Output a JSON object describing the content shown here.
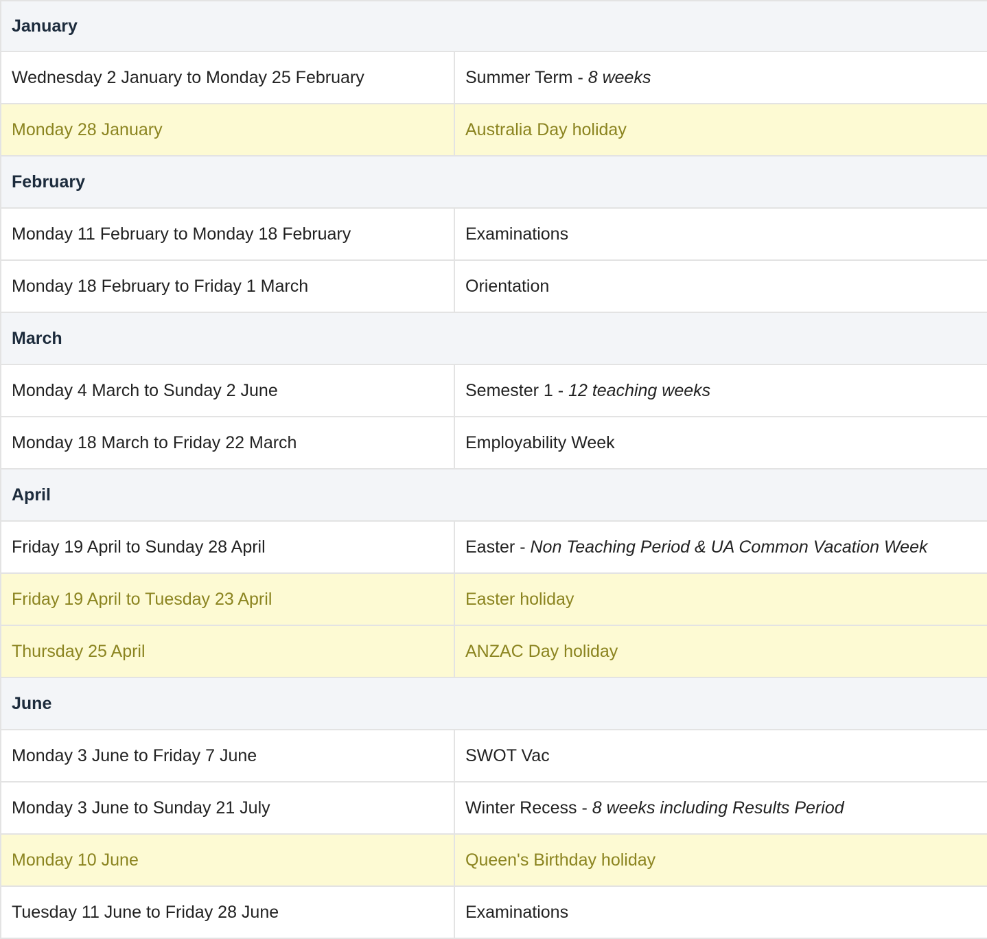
{
  "sections": [
    {
      "month": "January",
      "rows": [
        {
          "date": "Wednesday 2 January to Monday 25 February",
          "title": "Summer Term",
          "detail": "8 weeks",
          "holiday": false
        },
        {
          "date": "Monday 28 January",
          "title": "Australia Day holiday",
          "detail": "",
          "holiday": true
        }
      ]
    },
    {
      "month": "February",
      "rows": [
        {
          "date": "Monday 11 February to Monday 18 February",
          "title": "Examinations",
          "detail": "",
          "holiday": false
        },
        {
          "date": "Monday 18 February to Friday 1 March",
          "title": "Orientation",
          "detail": "",
          "holiday": false
        }
      ]
    },
    {
      "month": "March",
      "rows": [
        {
          "date": "Monday 4 March to Sunday 2 June",
          "title": "Semester 1",
          "detail": "12 teaching weeks",
          "holiday": false
        },
        {
          "date": "Monday 18 March to Friday 22 March",
          "title": "Employability Week",
          "detail": "",
          "holiday": false
        }
      ]
    },
    {
      "month": "April",
      "rows": [
        {
          "date": "Friday 19 April to Sunday 28 April",
          "title": "Easter",
          "detail": "Non Teaching Period & UA Common Vacation Week",
          "holiday": false
        },
        {
          "date": "Friday 19 April to Tuesday 23 April",
          "title": "Easter holiday",
          "detail": "",
          "holiday": true
        },
        {
          "date": "Thursday 25 April",
          "title": "ANZAC Day holiday",
          "detail": "",
          "holiday": true
        }
      ]
    },
    {
      "month": "June",
      "rows": [
        {
          "date": "Monday 3 June to Friday 7 June",
          "title": "SWOT Vac",
          "detail": "",
          "holiday": false
        },
        {
          "date": "Monday 3 June to Sunday 21 July",
          "title": "Winter Recess",
          "detail": "8 weeks including Results Period",
          "holiday": false
        },
        {
          "date": "Monday 10 June",
          "title": "Queen's Birthday holiday",
          "detail": "",
          "holiday": true
        },
        {
          "date": "Tuesday 11 June to Friday 28 June",
          "title": "Examinations",
          "detail": "",
          "holiday": false
        }
      ]
    }
  ],
  "separator": " - ",
  "colors": {
    "month_bg": "#f3f5f8",
    "holiday_bg": "#fdfad3",
    "holiday_text": "#8b8420",
    "month_text": "#1c2b3c",
    "border": "#e3e3e3"
  }
}
